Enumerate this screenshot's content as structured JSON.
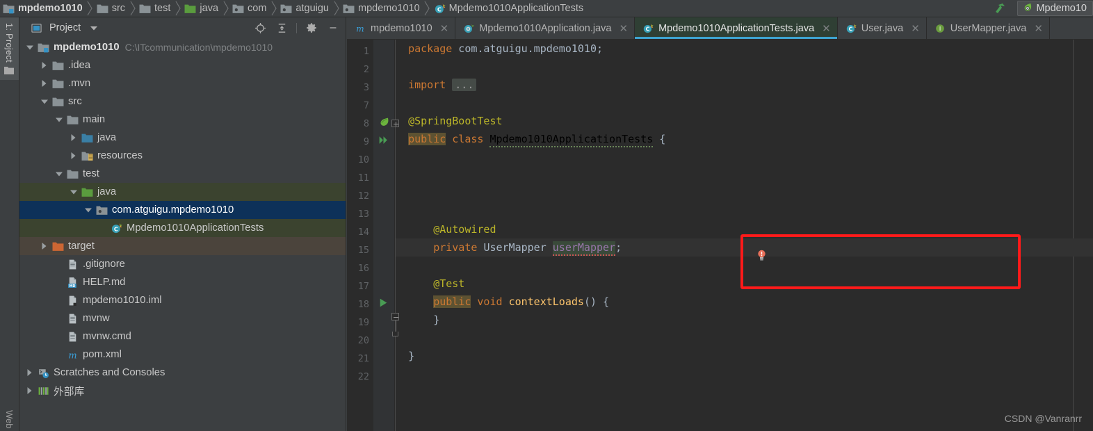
{
  "breadcrumb": [
    {
      "label": "mpdemo1010",
      "icon": "module-icon",
      "bold": true
    },
    {
      "label": "src",
      "icon": "folder-icon",
      "bold": false
    },
    {
      "label": "test",
      "icon": "folder-icon",
      "bold": false
    },
    {
      "label": "java",
      "icon": "source-folder-green-icon",
      "bold": false
    },
    {
      "label": "com",
      "icon": "package-icon",
      "bold": false
    },
    {
      "label": "atguigu",
      "icon": "package-icon",
      "bold": false
    },
    {
      "label": "mpdemo1010",
      "icon": "package-icon",
      "bold": false
    },
    {
      "label": "Mpdemo1010ApplicationTests",
      "icon": "java-class-icon",
      "bold": false
    }
  ],
  "toolbar_right": {
    "build_icon": "hammer-icon",
    "run_config": {
      "icon": "spring-boot-icon",
      "label": "Mpdemo10"
    }
  },
  "toolstrip": {
    "project_button": {
      "label": "1: Project",
      "icon": "project-folder-icon"
    },
    "bottom_button": {
      "label": "Web"
    }
  },
  "project_panel": {
    "title": "Project",
    "dropdown_icon": "chevron-down-icon",
    "panel_icon": "project-view-icon",
    "actions": [
      {
        "name": "locate-icon"
      },
      {
        "name": "collapse-all-icon"
      },
      {
        "name": "gear-icon"
      },
      {
        "name": "minimize-icon"
      }
    ],
    "tree": [
      {
        "label": "mpdemo1010",
        "path": "C:\\ITcommunication\\mpdemo1010",
        "indent": 0,
        "arrow": "down",
        "icon": "module-icon",
        "bold": true,
        "state": "normal"
      },
      {
        "label": ".idea",
        "path": "",
        "indent": 1,
        "arrow": "right",
        "icon": "folder-icon",
        "bold": false,
        "state": "normal"
      },
      {
        "label": ".mvn",
        "path": "",
        "indent": 1,
        "arrow": "right",
        "icon": "folder-icon",
        "bold": false,
        "state": "normal"
      },
      {
        "label": "src",
        "path": "",
        "indent": 1,
        "arrow": "down",
        "icon": "folder-icon",
        "bold": false,
        "state": "normal"
      },
      {
        "label": "main",
        "path": "",
        "indent": 2,
        "arrow": "down",
        "icon": "folder-icon",
        "bold": false,
        "state": "normal"
      },
      {
        "label": "java",
        "path": "",
        "indent": 3,
        "arrow": "right",
        "icon": "source-folder-blue-icon",
        "bold": false,
        "state": "normal"
      },
      {
        "label": "resources",
        "path": "",
        "indent": 3,
        "arrow": "right",
        "icon": "resources-folder-icon",
        "bold": false,
        "state": "normal"
      },
      {
        "label": "test",
        "path": "",
        "indent": 2,
        "arrow": "down",
        "icon": "folder-icon",
        "bold": false,
        "state": "normal"
      },
      {
        "label": "java",
        "path": "",
        "indent": 3,
        "arrow": "down",
        "icon": "source-folder-green-icon",
        "bold": false,
        "state": "testroot"
      },
      {
        "label": "com.atguigu.mpdemo1010",
        "path": "",
        "indent": 4,
        "arrow": "down",
        "icon": "package-icon",
        "bold": false,
        "state": "selected"
      },
      {
        "label": "Mpdemo1010ApplicationTests",
        "path": "",
        "indent": 5,
        "arrow": "none",
        "icon": "java-class-icon",
        "bold": false,
        "state": "testroot"
      },
      {
        "label": "target",
        "path": "",
        "indent": 1,
        "arrow": "right",
        "icon": "target-folder-icon",
        "bold": false,
        "state": "targetroot"
      },
      {
        "label": ".gitignore",
        "path": "",
        "indent": 2,
        "arrow": "none",
        "icon": "file-icon",
        "bold": false,
        "state": "normal"
      },
      {
        "label": "HELP.md",
        "path": "",
        "indent": 2,
        "arrow": "none",
        "icon": "markdown-file-icon",
        "bold": false,
        "state": "normal"
      },
      {
        "label": "mpdemo1010.iml",
        "path": "",
        "indent": 2,
        "arrow": "none",
        "icon": "iml-file-icon",
        "bold": false,
        "state": "normal"
      },
      {
        "label": "mvnw",
        "path": "",
        "indent": 2,
        "arrow": "none",
        "icon": "file-icon",
        "bold": false,
        "state": "normal"
      },
      {
        "label": "mvnw.cmd",
        "path": "",
        "indent": 2,
        "arrow": "none",
        "icon": "file-icon",
        "bold": false,
        "state": "normal"
      },
      {
        "label": "pom.xml",
        "path": "",
        "indent": 2,
        "arrow": "none",
        "icon": "maven-file-icon",
        "bold": false,
        "state": "normal"
      },
      {
        "label": "Scratches and Consoles",
        "path": "",
        "indent": 0,
        "arrow": "right",
        "icon": "scratches-icon",
        "bold": false,
        "state": "normal"
      },
      {
        "label": "外部库",
        "path": "",
        "indent": 0,
        "arrow": "right",
        "icon": "external-libraries-icon",
        "bold": false,
        "state": "normal"
      }
    ]
  },
  "editor": {
    "tabs": [
      {
        "label": "mpdemo1010",
        "icon": "maven-file-icon",
        "active": false,
        "closable": true
      },
      {
        "label": "Mpdemo1010Application.java",
        "icon": "spring-class-icon",
        "active": false,
        "closable": true
      },
      {
        "label": "Mpdemo1010ApplicationTests.java",
        "icon": "java-class-icon",
        "active": true,
        "closable": true
      },
      {
        "label": "User.java",
        "icon": "java-class-icon",
        "active": false,
        "closable": true
      },
      {
        "label": "UserMapper.java",
        "icon": "java-interface-icon",
        "active": false,
        "closable": true
      }
    ],
    "line_numbers": [
      "1",
      "2",
      "3",
      "7",
      "8",
      "9",
      "10",
      "11",
      "12",
      "13",
      "14",
      "15",
      "16",
      "17",
      "18",
      "19",
      "20",
      "21",
      "22"
    ],
    "gutter_marks": [
      {
        "line": "8",
        "icon": "spring-bean-icon"
      },
      {
        "line": "9",
        "icon": "run-all-tests-icon"
      },
      {
        "line": "18",
        "icon": "run-test-icon"
      },
      {
        "line": "14",
        "icon": "intention-bulb-icon"
      }
    ],
    "code_lines": [
      {
        "n": "1",
        "tokens": [
          {
            "t": "package",
            "c": "kw"
          },
          {
            "t": " com.atguigu.mpdemo1010;",
            "c": "plain"
          }
        ]
      },
      {
        "n": "2",
        "tokens": []
      },
      {
        "n": "3",
        "tokens": [
          {
            "t": "import",
            "c": "kw"
          },
          {
            "t": " ",
            "c": "plain"
          },
          {
            "t": "...",
            "c": "dots"
          }
        ]
      },
      {
        "n": "7",
        "tokens": []
      },
      {
        "n": "8",
        "tokens": [
          {
            "t": "@SpringBootTest",
            "c": "anno"
          }
        ]
      },
      {
        "n": "9",
        "tokens": [
          {
            "t": "public",
            "c": "hl-kw"
          },
          {
            "t": " ",
            "c": "plain"
          },
          {
            "t": "class",
            "c": "kw"
          },
          {
            "t": " ",
            "c": "plain"
          },
          {
            "t": "Mpdemo1010ApplicationTests",
            "c": "squig-green"
          },
          {
            "t": " {",
            "c": "plain"
          }
        ]
      },
      {
        "n": "10",
        "tokens": []
      },
      {
        "n": "11",
        "tokens": []
      },
      {
        "n": "12",
        "tokens": []
      },
      {
        "n": "13",
        "tokens": []
      },
      {
        "n": "14",
        "tokens": [
          {
            "t": "@Autowired",
            "c": "anno"
          }
        ]
      },
      {
        "n": "15",
        "tokens": [
          {
            "t": "private",
            "c": "kw"
          },
          {
            "t": " ",
            "c": "plain"
          },
          {
            "t": "UserMapper",
            "c": "cls"
          },
          {
            "t": " ",
            "c": "plain"
          },
          {
            "t": "userMapper",
            "c": "field-hl squig"
          },
          {
            "t": ";",
            "c": "plain"
          }
        ]
      },
      {
        "n": "16",
        "tokens": []
      },
      {
        "n": "17",
        "tokens": [
          {
            "t": "@Test",
            "c": "anno"
          }
        ]
      },
      {
        "n": "18",
        "tokens": [
          {
            "t": "public",
            "c": "hl-kw"
          },
          {
            "t": " ",
            "c": "plain"
          },
          {
            "t": "void",
            "c": "kw"
          },
          {
            "t": " ",
            "c": "plain"
          },
          {
            "t": "contextLoads",
            "c": "fn"
          },
          {
            "t": "() {",
            "c": "plain"
          }
        ]
      },
      {
        "n": "19",
        "tokens": [
          {
            "t": "}",
            "c": "plain"
          }
        ]
      },
      {
        "n": "20",
        "tokens": []
      },
      {
        "n": "21",
        "tokens": [
          {
            "t": "}",
            "c": "plain"
          }
        ]
      },
      {
        "n": "22",
        "tokens": []
      }
    ],
    "annotation_box": {
      "shape": "rectangle",
      "color": "#ff1a1a",
      "surrounds": "@Autowired private UserMapper userMapper;"
    },
    "caret_line": "15"
  },
  "watermark": "CSDN @Vanranrr",
  "colors": {
    "editor_bg": "#2b2b2b",
    "panel_bg": "#3c3f41",
    "selection_blue": "#0d3159",
    "test_root_green": "#3b432f",
    "active_tab_green": "#2f3f34",
    "tab_underline": "#3ea4d1",
    "annotation_red": "#ff1a1a",
    "keyword_orange": "#cc7832",
    "annotation_yellow": "#bbb529",
    "identifier_grey": "#a9b7c6",
    "method_yellow": "#ffc66d"
  }
}
